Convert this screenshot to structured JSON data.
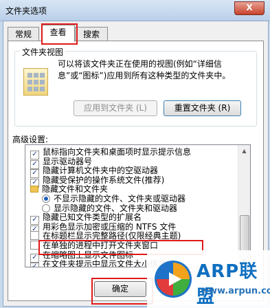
{
  "window": {
    "title": "文件夹选项",
    "close": "X"
  },
  "tabs": [
    {
      "label": "常规"
    },
    {
      "label": "查看"
    },
    {
      "label": "搜索"
    }
  ],
  "folder_view": {
    "group_title": "文件夹视图",
    "description": "可以将该文件夹正在使用的视图(例如“详细信息”或“图标”)应用到所有这种类型的文件夹中。",
    "apply_label": "应用到文件夹 (L)",
    "reset_label": "重置文件夹 (R)"
  },
  "advanced": {
    "label": "高级设置:",
    "items": [
      {
        "type": "checkbox",
        "checked": true,
        "label": "鼠标指向文件夹和桌面项时显示提示信息"
      },
      {
        "type": "checkbox",
        "checked": true,
        "label": "显示驱动器号"
      },
      {
        "type": "checkbox",
        "checked": true,
        "label": "隐藏计算机文件夹中的空驱动器"
      },
      {
        "type": "checkbox",
        "checked": true,
        "label": "隐藏受保护的操作系统文件(推荐)"
      },
      {
        "type": "folder",
        "label": "隐藏文件和文件夹"
      },
      {
        "type": "radio",
        "checked": true,
        "label": "不显示隐藏的文件、文件夹或驱动器"
      },
      {
        "type": "radio",
        "checked": false,
        "label": "显示隐藏的文件、文件夹和驱动器"
      },
      {
        "type": "checkbox",
        "checked": true,
        "label": "隐藏已知文件类型的扩展名"
      },
      {
        "type": "checkbox",
        "checked": true,
        "label": "用彩色显示加密或压缩的 NTFS 文件"
      },
      {
        "type": "checkbox",
        "checked": false,
        "label": "在标题栏显示完整路径(仅限经典主题)"
      },
      {
        "type": "checkbox",
        "checked": false,
        "label": "在单独的进程中打开文件夹窗口"
      },
      {
        "type": "checkbox",
        "checked": true,
        "label": "在缩略图上显示文件图标"
      },
      {
        "type": "checkbox",
        "checked": true,
        "label": "在文件夹提示中显示文件大小信息"
      }
    ],
    "check_mark": "✓"
  },
  "footer": {
    "ok_label": "确定"
  },
  "watermark": {
    "brand": "ARP联盟",
    "url": "www.arpun.com"
  },
  "colors": {
    "highlight": "#e01818",
    "brand": "#0f6fc0"
  }
}
